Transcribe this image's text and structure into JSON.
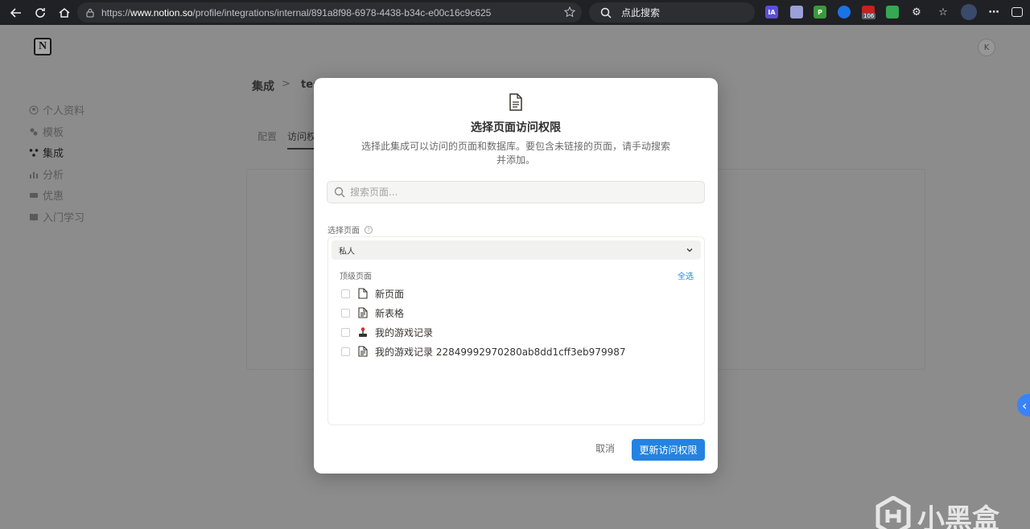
{
  "browser": {
    "url_prefix": "https://",
    "url_host": "www.notion.so",
    "url_path": "/profile/integrations/internal/891a8f98-6978-4438-b34c-e00c16c9c625",
    "search_placeholder": "点此搜索",
    "extensions": [
      {
        "label": "IA",
        "color": "#5b4fd6"
      },
      {
        "label": "",
        "color": "#9aa0d8"
      },
      {
        "label": "P",
        "color": "#3a9a3a"
      },
      {
        "label": "",
        "color": "#1a73e8"
      },
      {
        "label": "",
        "color": "#c5221f",
        "badge": "106"
      },
      {
        "label": "",
        "color": "#34a853"
      }
    ]
  },
  "notion": {
    "logo": "N",
    "avatar": "K",
    "sidebar": [
      {
        "label": "个人资料",
        "icon": "user-circle-icon"
      },
      {
        "label": "模板",
        "icon": "template-icon"
      },
      {
        "label": "集成",
        "icon": "integration-icon"
      },
      {
        "label": "分析",
        "icon": "chart-icon"
      },
      {
        "label": "优惠",
        "icon": "ticket-icon"
      },
      {
        "label": "入门学习",
        "icon": "book-icon"
      }
    ],
    "breadcrumb": {
      "root": "集成",
      "sep": ">",
      "current": "tes"
    },
    "tabs": [
      "配置",
      "访问权"
    ]
  },
  "modal": {
    "title": "选择页面访问权限",
    "description": "选择此集成可以访问的页面和数据库。要包含未链接的页面，请手动搜索并添加。",
    "search_placeholder": "搜索页面...",
    "section_label": "选择页面",
    "help_glyph": "?",
    "workspace": "私人",
    "top_pages_label": "顶级页面",
    "select_all": "全选",
    "pages": [
      {
        "title": "新页面",
        "icon": "document-icon"
      },
      {
        "title": "新表格",
        "icon": "document-lines-icon"
      },
      {
        "title": "我的游戏记录",
        "icon": "joystick-icon"
      },
      {
        "title": "我的游戏记录 22849992970280ab8dd1cff3eb979987",
        "icon": "document-lines-icon"
      }
    ],
    "cancel_label": "取消",
    "confirm_label": "更新访问权限"
  },
  "watermark": {
    "text": "小黑盒"
  },
  "colors": {
    "accent": "#2383e2",
    "overlay": "#8c8c8c"
  }
}
